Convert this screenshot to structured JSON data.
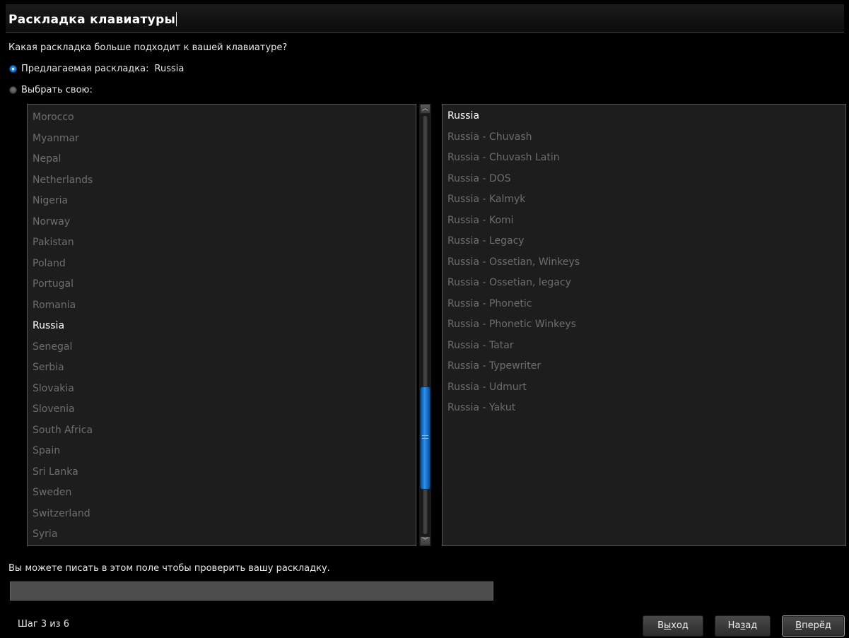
{
  "title": "Раскладка клавиатуры",
  "question": "Какая раскладка больше подходит к вашей клавиатуре?",
  "suggested": {
    "label": "Предлагаемая раскладка:",
    "value": "Russia",
    "checked": true
  },
  "custom": {
    "label": "Выбрать свою:",
    "checked": false
  },
  "countries": {
    "items": [
      "Morocco",
      "Myanmar",
      "Nepal",
      "Netherlands",
      "Nigeria",
      "Norway",
      "Pakistan",
      "Poland",
      "Portugal",
      "Romania",
      "Russia",
      "Senegal",
      "Serbia",
      "Slovakia",
      "Slovenia",
      "South Africa",
      "Spain",
      "Sri Lanka",
      "Sweden",
      "Switzerland",
      "Syria"
    ],
    "selected": "Russia"
  },
  "variants": {
    "items": [
      "Russia",
      "Russia - Chuvash",
      "Russia - Chuvash Latin",
      "Russia - DOS",
      "Russia - Kalmyk",
      "Russia - Komi",
      "Russia - Legacy",
      "Russia - Ossetian, Winkeys",
      "Russia - Ossetian, legacy",
      "Russia - Phonetic",
      "Russia - Phonetic Winkeys",
      "Russia - Tatar",
      "Russia - Typewriter",
      "Russia - Udmurt",
      "Russia - Yakut"
    ],
    "selected": "Russia"
  },
  "test": {
    "label": "Вы можете писать в этом поле чтобы проверить вашу раскладку.",
    "value": ""
  },
  "step": "Шаг 3 из 6",
  "buttons": {
    "exit": {
      "before": "В",
      "mnemonic": "ы",
      "after": "ход"
    },
    "back": {
      "before": "На",
      "mnemonic": "з",
      "after": "ад"
    },
    "next": {
      "before": "",
      "mnemonic": "В",
      "after": "перёд"
    }
  },
  "icons": {
    "scroll_up": "scroll-up-arrow-icon",
    "scroll_down": "scroll-down-arrow-icon"
  },
  "colors": {
    "accent": "#2a91ee",
    "list_bg": "#1d1d1d",
    "dim_text": "#6e6e6e"
  }
}
